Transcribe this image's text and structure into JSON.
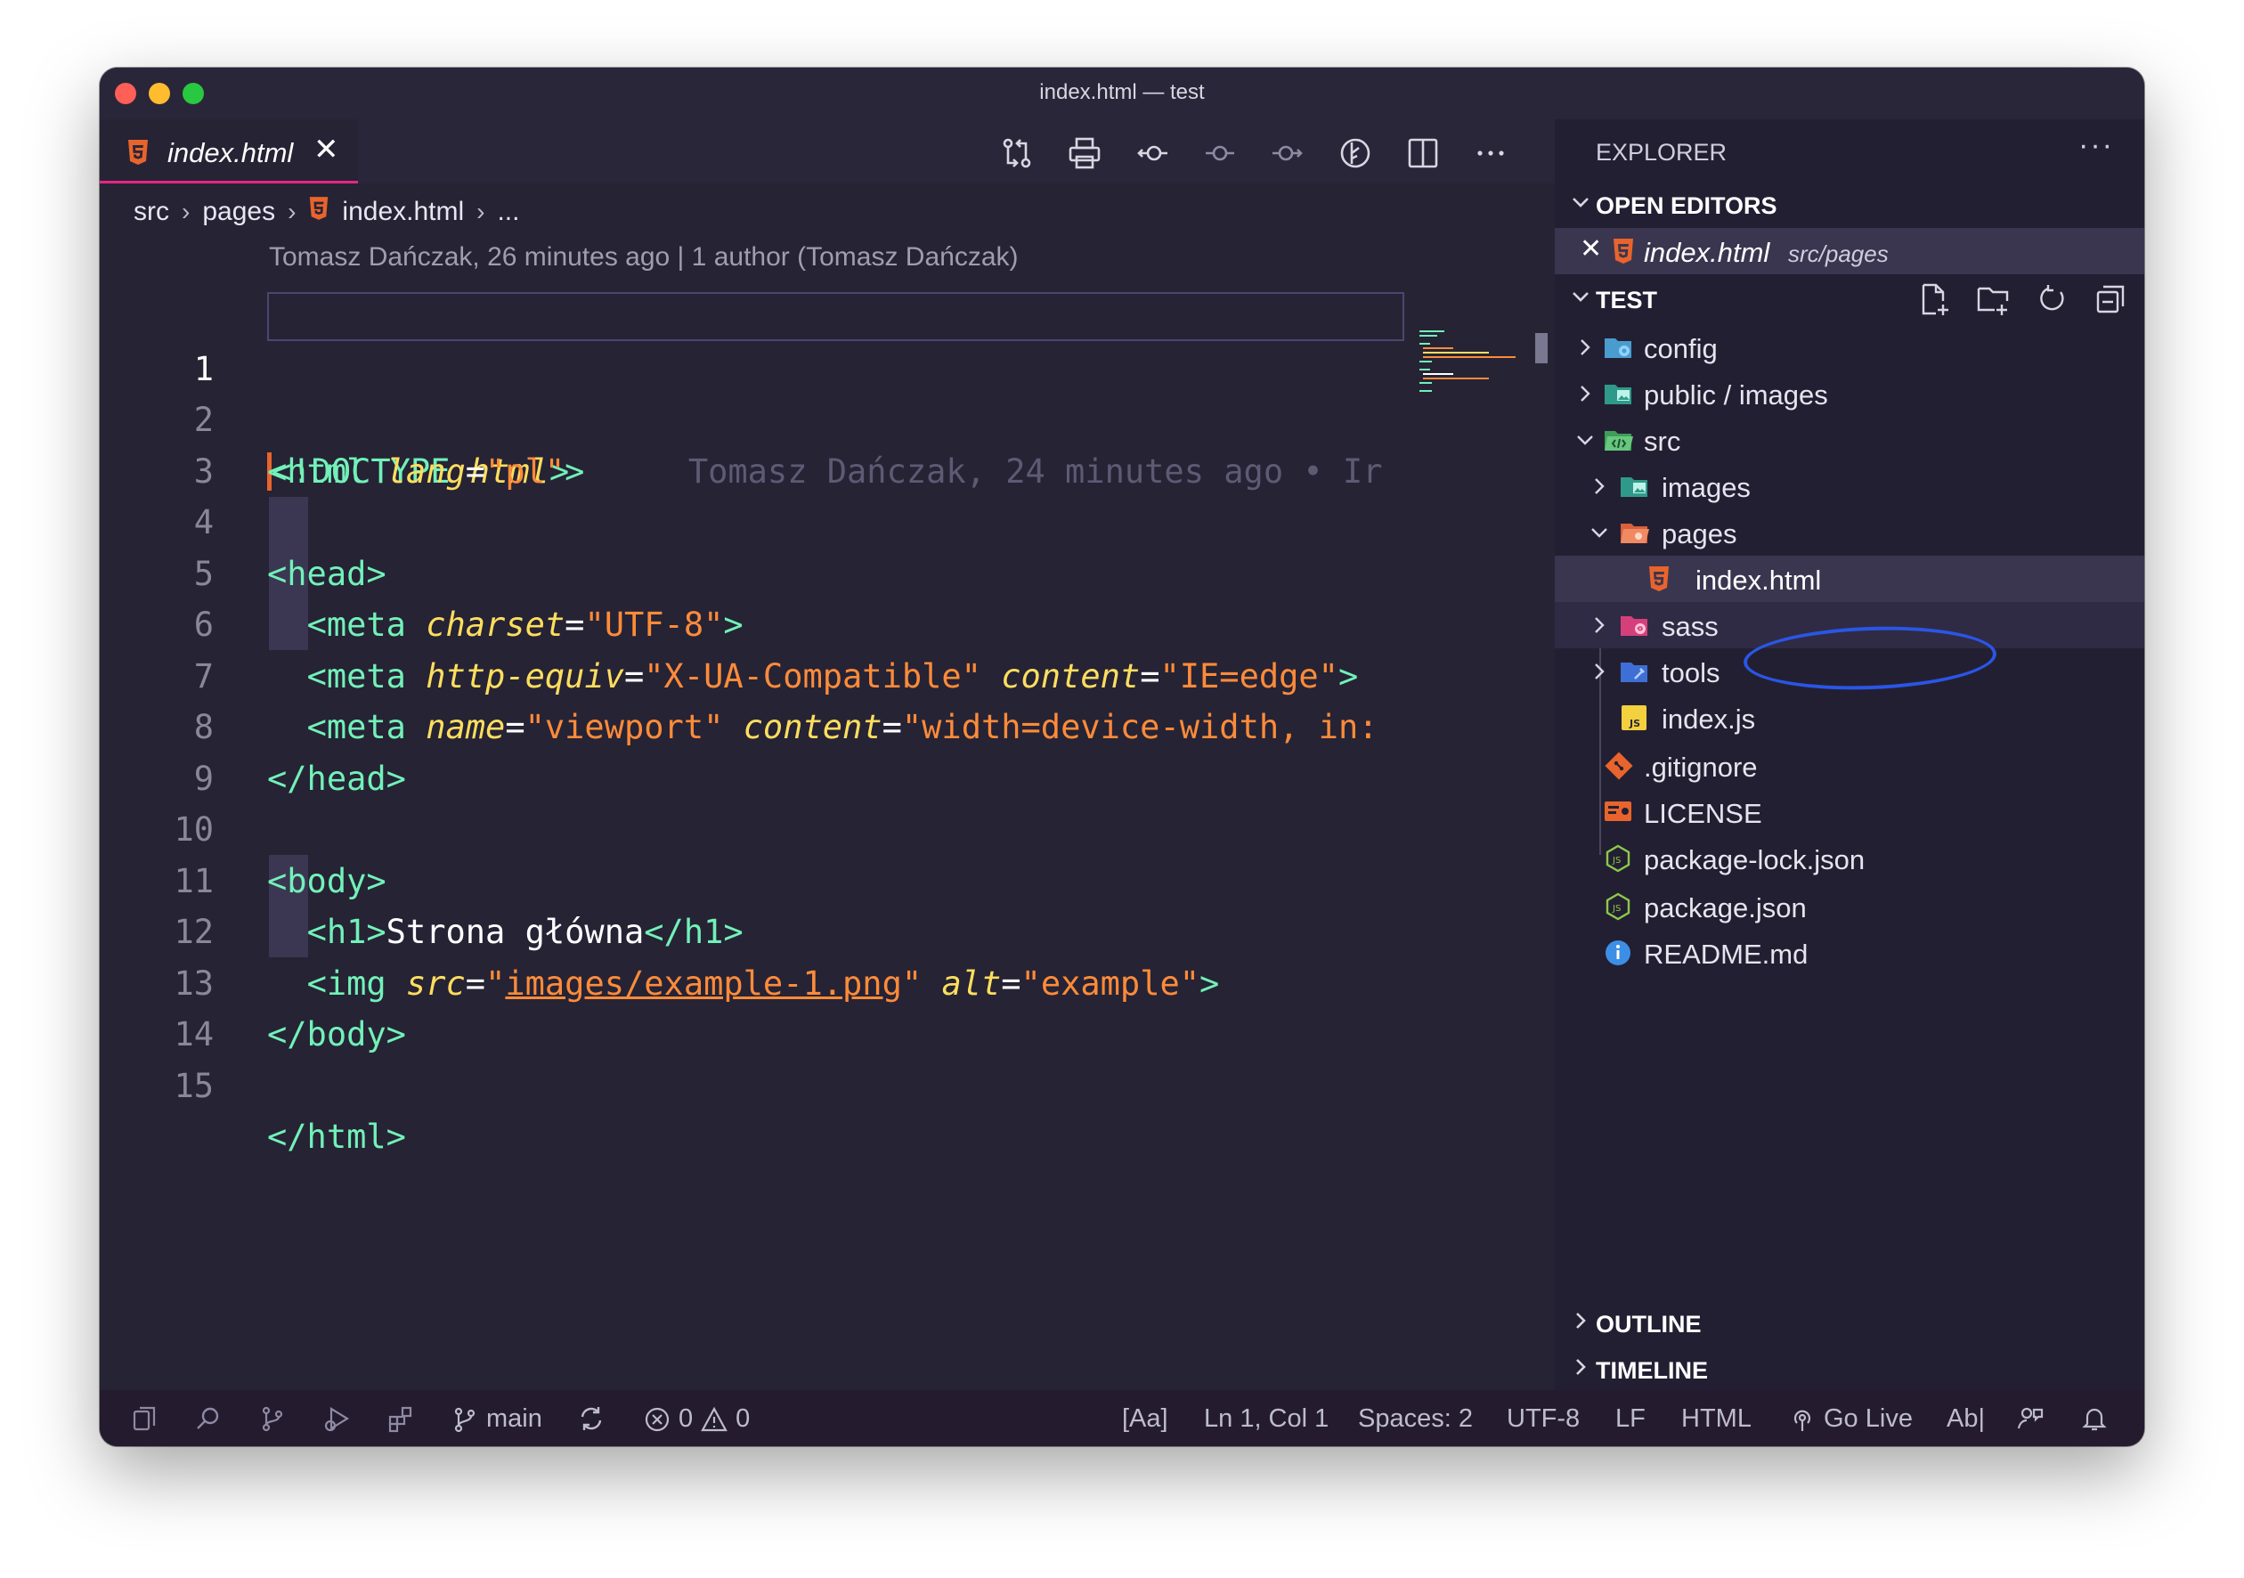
{
  "window": {
    "title": "index.html — test"
  },
  "tabs": [
    {
      "label": "index.html",
      "close": "✕"
    }
  ],
  "breadcrumb": [
    "src",
    "pages",
    "index.html",
    "..."
  ],
  "blame": {
    "header": "Tomasz Dańczak, 26 minutes ago | 1 author (Tomasz Dańczak)",
    "inline": "Tomasz Dańczak, 24 minutes ago • Ir"
  },
  "code": {
    "active_line": 1,
    "line_numbers": [
      "1",
      "2",
      "3",
      "4",
      "5",
      "6",
      "7",
      "8",
      "9",
      "10",
      "11",
      "12",
      "13",
      "14",
      "15"
    ],
    "l1": {
      "open": "<",
      "rest": "!DOCTYPE ",
      "kw": "html",
      "close": ">"
    },
    "l2": {
      "tag": "<html ",
      "attr": "lang",
      "eq": "=",
      "val": "\"pl\"",
      "end": ">"
    },
    "l4": {
      "tag": "<head>"
    },
    "l5": {
      "tag": "<meta ",
      "attr": "charset",
      "eq": "=",
      "val": "\"UTF-8\"",
      "end": ">"
    },
    "l6": {
      "tag": "<meta ",
      "attr1": "http-equiv",
      "eq": "=",
      "val1": "\"X-UA-Compatible\"",
      "sp": " ",
      "attr2": "content",
      "val2": "\"IE=edge\"",
      "end": ">"
    },
    "l7": {
      "tag": "<meta ",
      "attr1": "name",
      "eq": "=",
      "val1": "\"viewport\"",
      "sp": " ",
      "attr2": "content",
      "val2": "\"width=device-width, in:"
    },
    "l8": {
      "tag": "</head>"
    },
    "l10": {
      "tag": "<body>"
    },
    "l11": {
      "open": "<h1>",
      "text": "Strona główna",
      "close": "</h1>"
    },
    "l12": {
      "tag": "<img ",
      "attr1": "src",
      "eq": "=",
      "q": "\"",
      "link": "images/example-1.png",
      "sp": " ",
      "attr2": "alt",
      "val2": "\"example\"",
      "end": ">"
    },
    "l13": {
      "tag": "</body>"
    },
    "l15": {
      "tag": "</html>"
    }
  },
  "sidebar": {
    "title": "EXPLORER",
    "more": "···",
    "open_editors": {
      "label": "OPEN EDITORS",
      "items": [
        {
          "name": "index.html",
          "path": "src/pages"
        }
      ]
    },
    "project": {
      "label": "TEST",
      "tree": [
        {
          "name": "config",
          "icon": "folder-config-icon"
        },
        {
          "name": "public / images",
          "icon": "folder-images-icon"
        },
        {
          "name": "src",
          "icon": "folder-src-icon"
        },
        {
          "name": "images",
          "icon": "folder-images-icon"
        },
        {
          "name": "pages",
          "icon": "folder-pages-icon"
        },
        {
          "name": "index.html",
          "icon": "html-file-icon"
        },
        {
          "name": "sass",
          "icon": "folder-sass-icon"
        },
        {
          "name": "tools",
          "icon": "folder-tools-icon"
        },
        {
          "name": "index.js",
          "icon": "js-file-icon"
        },
        {
          "name": ".gitignore",
          "icon": "git-icon"
        },
        {
          "name": "LICENSE",
          "icon": "license-icon"
        },
        {
          "name": "package-lock.json",
          "icon": "nodejs-icon"
        },
        {
          "name": "package.json",
          "icon": "nodejs-icon"
        },
        {
          "name": "README.md",
          "icon": "info-icon"
        }
      ]
    },
    "outline": "OUTLINE",
    "timeline": "TIMELINE"
  },
  "status": {
    "branch": "main",
    "errors": "0",
    "warnings": "0",
    "case": "[Aa]",
    "position": "Ln 1, Col 1",
    "spaces": "Spaces: 2",
    "encoding": "UTF-8",
    "eol": "LF",
    "language": "HTML",
    "golive": "Go Live",
    "spell": "Ab|"
  },
  "colors": {
    "tag": "#72f1b8",
    "attribute": "#fede5d",
    "string": "#ff8b39",
    "tab_accent": "#e82685",
    "annotation": "#2a56e6"
  }
}
